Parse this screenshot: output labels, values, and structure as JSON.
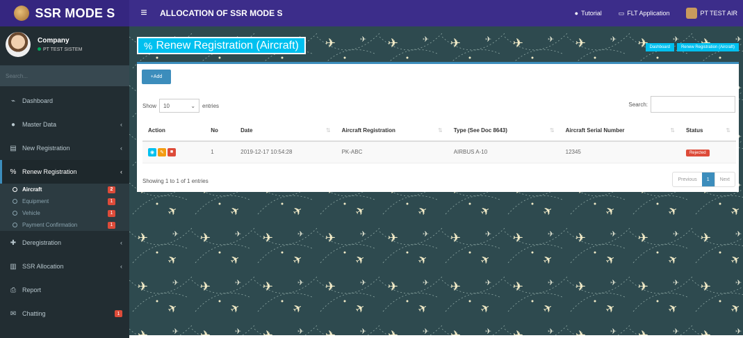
{
  "header": {
    "app_name": "SSR MODE S",
    "menu_icon": "hamburger-icon",
    "title": "ALLOCATION OF SSR MODE S",
    "links": [
      {
        "label": "Tutorial",
        "icon": "info-icon"
      },
      {
        "label": "FLT Application",
        "icon": "monitor-icon"
      },
      {
        "label": "PT TEST AIR",
        "icon": "avatar"
      }
    ]
  },
  "user": {
    "name": "Company",
    "org": "PT TEST SISTEM"
  },
  "sidebar": {
    "search_placeholder": "Search...",
    "items": [
      {
        "label": "Dashboard",
        "icon": "chart-icon"
      },
      {
        "label": "Master Data",
        "icon": "circle-icon"
      },
      {
        "label": "New Registration",
        "icon": "file-icon"
      },
      {
        "label": "Renew Registration",
        "icon": "link-icon"
      },
      {
        "label": "Deregistration",
        "icon": "pin-icon"
      },
      {
        "label": "SSR Allocation",
        "icon": "bar-chart-icon"
      },
      {
        "label": "Report",
        "icon": "print-icon"
      },
      {
        "label": "Chatting",
        "icon": "chat-icon"
      }
    ],
    "renew_sub": [
      {
        "label": "Aircraft",
        "badge": "2"
      },
      {
        "label": "Equipment",
        "badge": "1"
      },
      {
        "label": "Vehicle",
        "badge": "1"
      },
      {
        "label": "Payment Confirmation",
        "badge": "1"
      }
    ],
    "chatting_badge": "1"
  },
  "page": {
    "title": "Renew Registration (Aircraft)",
    "breadcrumb": [
      "Dashboard",
      "Renew Registration (Aircraft)"
    ]
  },
  "table_controls": {
    "add_label": "Add",
    "show_label": "Show",
    "entries_value": "10",
    "entries_label": "entries",
    "search_label": "Search:"
  },
  "table": {
    "columns": [
      "Action",
      "No",
      "Date",
      "Aircraft Registration",
      "Type (See Doc 8643)",
      "Aircraft Serial Number",
      "Status"
    ],
    "rows": [
      {
        "no": "1",
        "date": "2019-12-17 10:54:28",
        "registration": "PK-ABC",
        "type": "AIRBUS A-10",
        "serial": "12345",
        "status": "Rejected"
      }
    ]
  },
  "footer": {
    "showing": "Showing 1 to 1 of 1 entries",
    "previous": "Previous",
    "page": "1",
    "next": "Next"
  },
  "colors": {
    "header": "#3c2d8a",
    "sidebar": "#222d32",
    "accent": "#00c0ef",
    "primary": "#3c8dbc",
    "danger": "#dd4b39",
    "warning": "#f39c12",
    "background": "#2e4a4f"
  }
}
